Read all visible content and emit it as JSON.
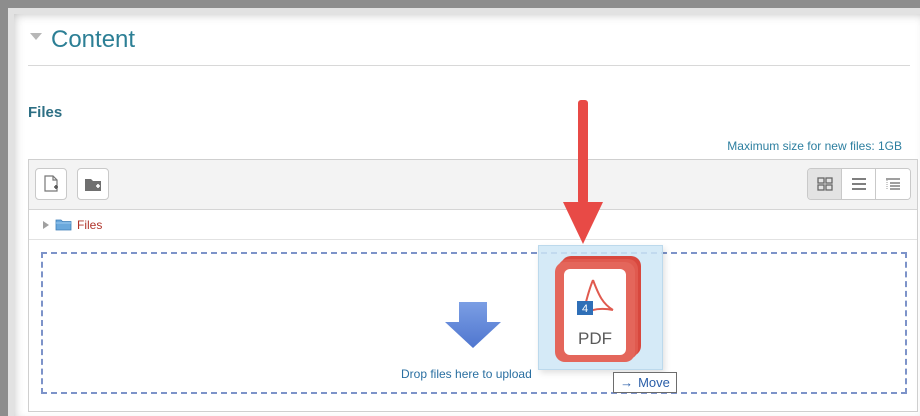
{
  "section": {
    "title": "Content"
  },
  "files": {
    "label": "Files",
    "max_size_text": "Maximum size for new files: 1GB"
  },
  "toolbar": {
    "add_file_icon": "add-file-icon",
    "create_folder_icon": "create-folder-icon",
    "view_modes": [
      "icons-view",
      "list-view",
      "tree-view"
    ],
    "active_view": "icons-view"
  },
  "path": {
    "label": "Files"
  },
  "dropzone": {
    "text": "Drop files here to upload"
  },
  "drag": {
    "file_type": "PDF",
    "badge": "4",
    "tooltip": "Move"
  },
  "colors": {
    "accent": "#2c7f95",
    "path_link": "#b0342a",
    "pdf_red": "#e05a4f",
    "arrow_red": "#e84a46",
    "drop_border": "#7d93c9",
    "upload_arrow": "#5b82d6"
  }
}
